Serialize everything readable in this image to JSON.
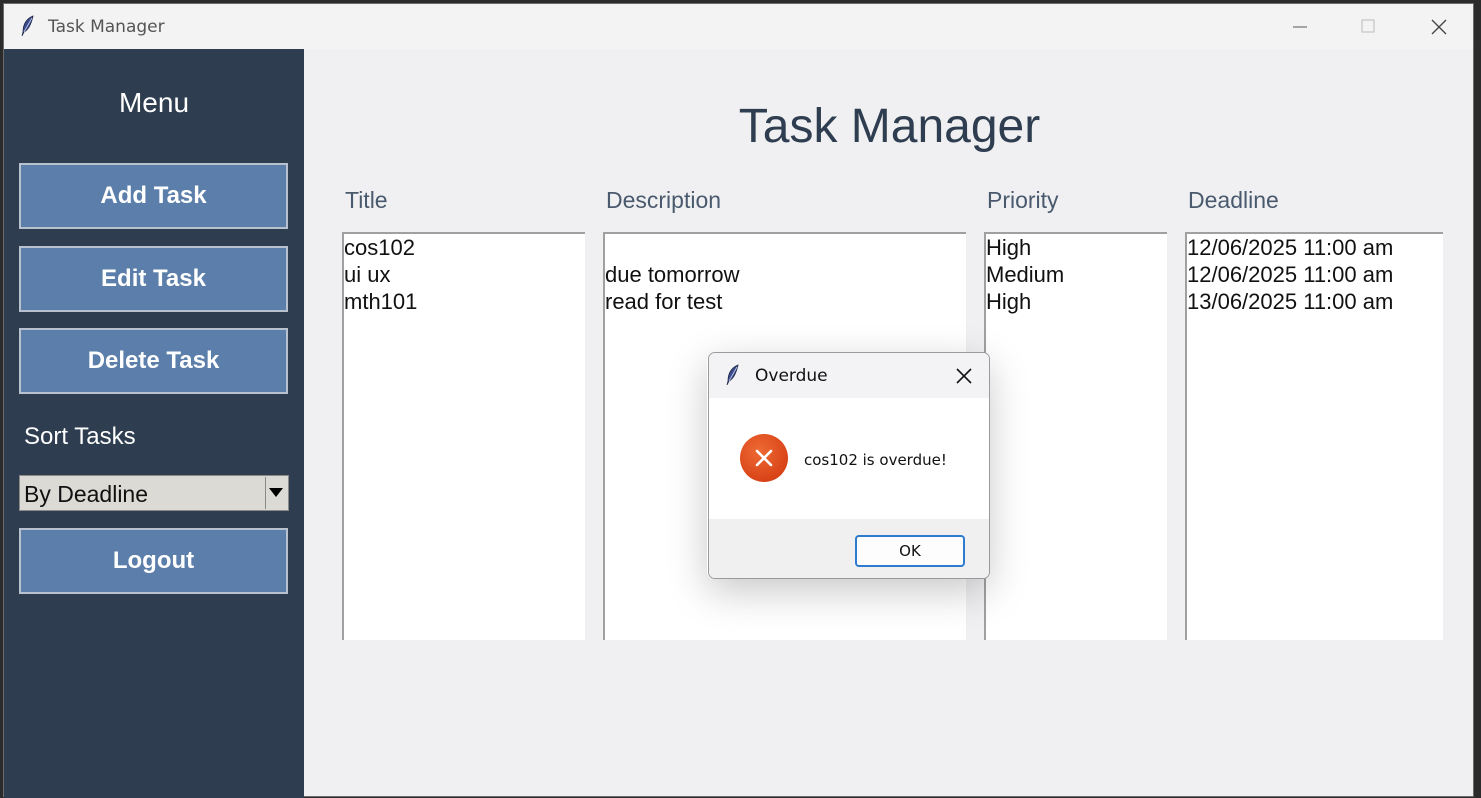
{
  "window": {
    "title": "Task Manager"
  },
  "sidebar": {
    "menu_title": "Menu",
    "buttons": [
      "Add Task",
      "Edit Task",
      "Delete Task"
    ],
    "sort_label": "Sort Tasks",
    "sort_value": "By Deadline",
    "logout_label": "Logout"
  },
  "main": {
    "title": "Task Manager",
    "columns": {
      "title": "Title",
      "description": "Description",
      "priority": "Priority",
      "deadline": "Deadline"
    },
    "rows": {
      "titles": [
        "cos102",
        "ui ux",
        "mth101"
      ],
      "descriptions": [
        "",
        "due tomorrow",
        "read for test"
      ],
      "priorities": [
        "High",
        "Medium",
        "High"
      ],
      "deadlines": [
        "12/06/2025 11:00 am",
        "12/06/2025 11:00 am",
        "13/06/2025 11:00 am"
      ]
    }
  },
  "dialog": {
    "title": "Overdue",
    "message": "cos102 is overdue!",
    "ok_label": "OK"
  },
  "colors": {
    "sidebar_bg": "#2e3e50",
    "button_bg": "#5b7faa",
    "error_icon": "#d94418",
    "ok_border": "#2e7bd0"
  },
  "icons": {
    "app": "feather-icon",
    "error": "error-x-icon"
  }
}
